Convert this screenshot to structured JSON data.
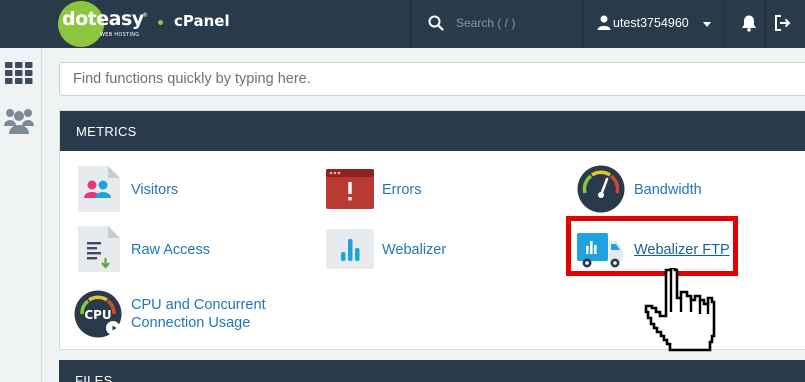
{
  "header": {
    "logo_text_dot": "dot",
    "logo_text_easy": "easy",
    "logo_subtext": "WEB HOSTING",
    "logo_registered": "®",
    "brand": "cPanel",
    "search_placeholder": "Search ( / )",
    "username": "utest3754960"
  },
  "find": {
    "placeholder": "Find functions quickly by typing here."
  },
  "metrics": {
    "title": "METRICS",
    "items": [
      {
        "label": "Visitors"
      },
      {
        "label": "Errors"
      },
      {
        "label": "Bandwidth"
      },
      {
        "label": "Raw Access"
      },
      {
        "label": "Webalizer"
      },
      {
        "label": "Webalizer FTP"
      },
      {
        "label": "CPU and Concurrent",
        "label2": "Connection Usage",
        "icon_text": "CPU"
      }
    ]
  },
  "files": {
    "title": "FILES"
  },
  "colors": {
    "header_bg": "#293a4a",
    "accent_green": "#8cc63f",
    "link": "#1f77b9",
    "highlight": "#e20000"
  }
}
